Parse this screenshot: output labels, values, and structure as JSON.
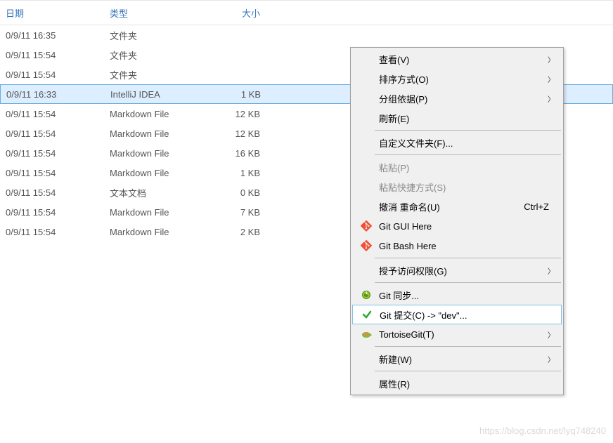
{
  "headers": {
    "date": "日期",
    "type": "类型",
    "size": "大小"
  },
  "rows": [
    {
      "date": "0/9/11 16:35",
      "type": "文件夹",
      "size": ""
    },
    {
      "date": "0/9/11 15:54",
      "type": "文件夹",
      "size": ""
    },
    {
      "date": "0/9/11 15:54",
      "type": "文件夹",
      "size": ""
    },
    {
      "date": "0/9/11 16:33",
      "type": "IntelliJ IDEA",
      "size": "1 KB",
      "selected": true
    },
    {
      "date": "0/9/11 15:54",
      "type": "Markdown File",
      "size": "12 KB"
    },
    {
      "date": "0/9/11 15:54",
      "type": "Markdown File",
      "size": "12 KB"
    },
    {
      "date": "0/9/11 15:54",
      "type": "Markdown File",
      "size": "16 KB"
    },
    {
      "date": "0/9/11 15:54",
      "type": "Markdown File",
      "size": "1 KB"
    },
    {
      "date": "0/9/11 15:54",
      "type": "文本文档",
      "size": "0 KB"
    },
    {
      "date": "0/9/11 15:54",
      "type": "Markdown File",
      "size": "7 KB"
    },
    {
      "date": "0/9/11 15:54",
      "type": "Markdown File",
      "size": "2 KB"
    }
  ],
  "menu": {
    "view": "查看(V)",
    "sort": "排序方式(O)",
    "group": "分组依据(P)",
    "refresh": "刷新(E)",
    "customize": "自定义文件夹(F)...",
    "paste": "粘贴(P)",
    "paste_shortcut": "粘贴快捷方式(S)",
    "undo": "撤消 重命名(U)",
    "undo_key": "Ctrl+Z",
    "gitgui": "Git GUI Here",
    "gitbash": "Git Bash Here",
    "access": "授予访问权限(G)",
    "gitsync": "Git 同步...",
    "gitcommit": "Git 提交(C) -> \"dev\"...",
    "tortoise": "TortoiseGit(T)",
    "new": "新建(W)",
    "props": "属性(R)"
  },
  "watermark": "https://blog.csdn.net/lyq748240"
}
